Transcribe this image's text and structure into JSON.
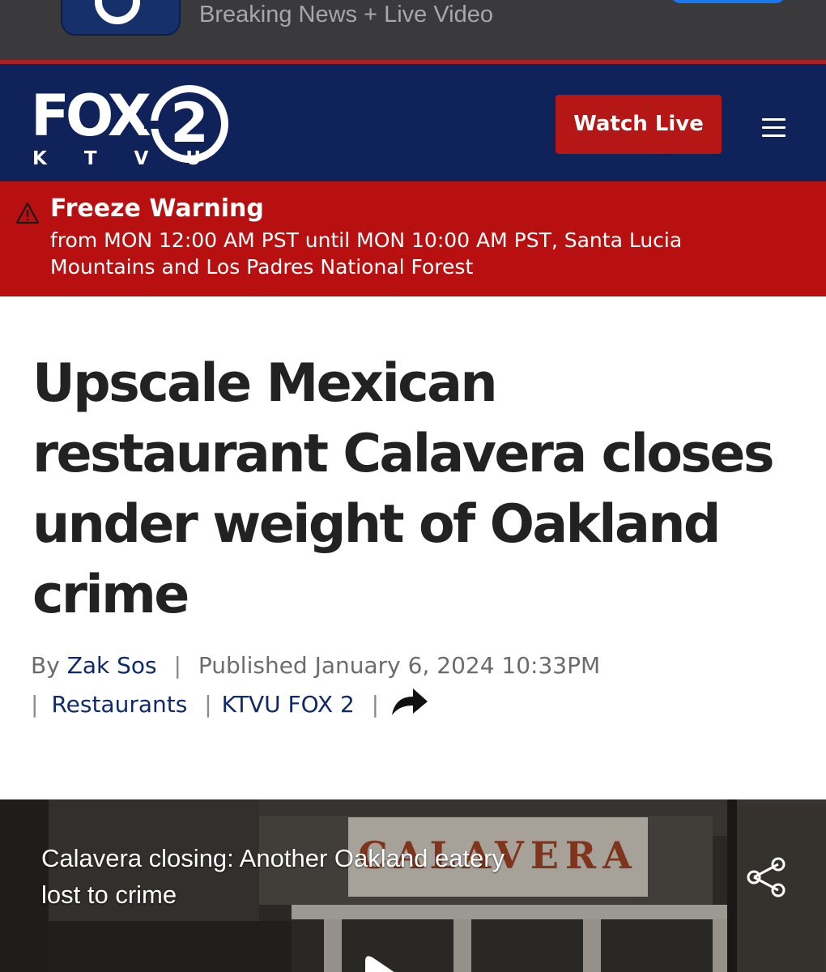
{
  "app_banner": {
    "subtitle": "Breaking News + Live Video",
    "icon": "fox2-app-icon"
  },
  "header": {
    "logo": {
      "brand": "FOX",
      "number": "2",
      "callsign": "K T V U"
    },
    "watch_live_label": "Watch Live",
    "menu_icon": "hamburger-menu-icon"
  },
  "alert": {
    "icon": "warning-triangle-icon",
    "title": "Freeze Warning",
    "body": "from MON 12:00 AM PST until MON 10:00 AM PST, Santa Lucia Mountains and Los Padres National Forest"
  },
  "article": {
    "headline": "Upscale Mexican restaurant Calavera closes under weight of Oakland crime",
    "byline_prefix": "By",
    "author": "Zak Sos",
    "published": "Published January 6, 2024 10:33PM",
    "category": "Restaurants",
    "source": "KTVU FOX 2",
    "separator": "|",
    "share_icon": "share-arrow-icon"
  },
  "video": {
    "caption": "Calavera closing: Another Oakland eatery lost to crime",
    "sign_text": "CALAVERA",
    "share_icon": "share-nodes-icon",
    "play_icon": "play-icon"
  },
  "colors": {
    "app_banner_bg": "#3a3a3c",
    "header_bg": "#0f2259",
    "watch_live_bg": "#b51717",
    "alert_bg": "#b81010",
    "link": "#10296b",
    "headline": "#222222"
  }
}
